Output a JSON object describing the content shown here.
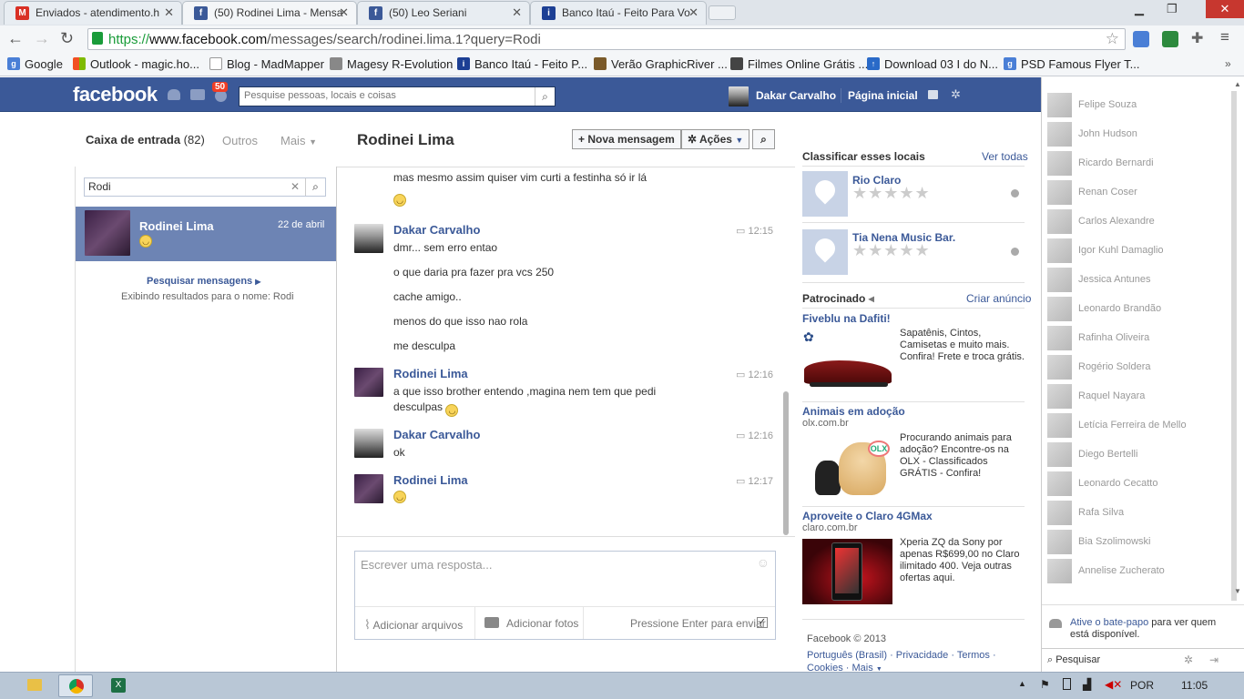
{
  "browser": {
    "tabs": [
      {
        "label": "Enviados - atendimento.h",
        "icon": "gmail-icon"
      },
      {
        "label": "(50) Rodinei Lima - Mensa",
        "icon": "facebook-icon"
      },
      {
        "label": "(50) Leo Seriani",
        "icon": "facebook-icon"
      },
      {
        "label": "Banco Itaú - Feito Para Vo",
        "icon": "itau-icon"
      }
    ],
    "url_scheme": "https://",
    "url_host": "www.facebook.com",
    "url_path": "/messages/search/rodinei.lima.1?query=Rodi",
    "bookmarks": [
      "Google",
      "Outlook - magic.ho...",
      "Blog - MadMapper",
      "Magesy R-Evolution",
      "Banco Itaú - Feito P...",
      "Verão GraphicRiver ...",
      "Filmes Online Grátis ...",
      "Download 03 I do N...",
      "PSD Famous Flyer T..."
    ]
  },
  "fb_header": {
    "logo": "facebook",
    "notification_count": "50",
    "search_placeholder": "Pesquise pessoas, locais e coisas",
    "user_name": "Dakar Carvalho",
    "home_link": "Página inicial"
  },
  "inbox": {
    "title": "Caixa de entrada",
    "count": "(82)",
    "others": "Outros",
    "more": "Mais",
    "search_value": "Rodi",
    "threads": [
      {
        "name": "Rodinei Lima",
        "date": "22 de abril"
      }
    ],
    "search_messages_link": "Pesquisar mensagens",
    "search_results_text": "Exibindo resultados para o nome: Rodi"
  },
  "conversation": {
    "title": "Rodinei Lima",
    "new_message_button": "Nova mensagem",
    "actions_button": "Ações",
    "top_line": "mas mesmo assim quiser vim curti a festinha só ir lá",
    "messages": [
      {
        "sender": "Dakar Carvalho",
        "time": "12:15",
        "lines": [
          "dmr... sem erro entao",
          "o que daria pra fazer pra vcs 250",
          "cache amigo..",
          "menos do que isso nao rola",
          "me desculpa"
        ]
      },
      {
        "sender": "Rodinei Lima",
        "time": "12:16",
        "lines": [
          "a que isso brother entendo ,magina nem tem que pedi",
          "desculpas"
        ]
      },
      {
        "sender": "Dakar Carvalho",
        "time": "12:16",
        "lines": [
          "ok"
        ]
      },
      {
        "sender": "Rodinei Lima",
        "time": "12:17",
        "lines": []
      }
    ],
    "reply_placeholder": "Escrever uma resposta...",
    "add_files": "Adicionar arquivos",
    "add_photos": "Adicionar fotos",
    "press_enter": "Pressione Enter para enviar"
  },
  "right_column": {
    "rate_places_title": "Classificar esses locais",
    "see_all": "Ver todas",
    "places": [
      "Rio Claro",
      "Tia Nena Music Bar."
    ],
    "sponsored_title": "Patrocinado",
    "create_ad": "Criar anúncio",
    "ads": [
      {
        "title": "Fiveblu na Dafiti!",
        "domain": "",
        "text": "Sapatênis, Cintos, Camisetas e muito mais. Confira! Frete e troca grátis."
      },
      {
        "title": "Animais em adoção",
        "domain": "olx.com.br",
        "text": "Procurando animais para adoção? Encontre-os na OLX - Classificados GRÁTIS - Confira!"
      },
      {
        "title": "Aproveite o Claro 4GMax",
        "domain": "claro.com.br",
        "text": "Xperia ZQ da Sony por apenas R$699,00 no Claro ilimitado 400. Veja outras ofertas aqui."
      }
    ],
    "footer_copyright": "Facebook © 2013",
    "footer_links": "Português (Brasil) · Privacidade · Termos ·",
    "footer_links2": "Cookies · Mais"
  },
  "chat": {
    "friends": [
      "Felipe Souza",
      "John Hudson",
      "Ricardo Bernardi",
      "Renan Coser",
      "Carlos Alexandre",
      "Igor Kuhl Damaglio",
      "Jessica Antunes",
      "Leonardo Brandão",
      "Rafinha Oliveira",
      "Rogério Soldera",
      "Raquel Nayara",
      "Letícia Ferreira de Mello",
      "Diego Bertelli",
      "Leonardo Cecatto",
      "Rafa Silva",
      "Bia Szolimowski",
      "Annelise Zucherato"
    ],
    "enable_text_1": "Ative o bate-papo",
    "enable_text_2": " para ver quem está disponível.",
    "search_label": "Pesquisar"
  },
  "taskbar": {
    "language": "POR",
    "clock": "11:05"
  },
  "colors": {
    "fb_blue": "#3b5998",
    "selected_thread": "#6d84b4",
    "notification_red": "#f03d25"
  }
}
